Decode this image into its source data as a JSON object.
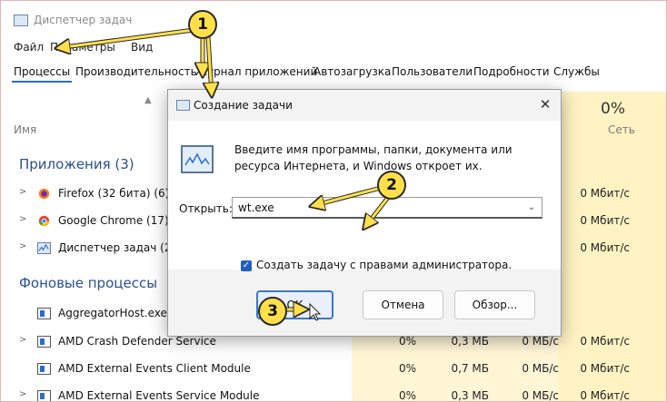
{
  "app": {
    "title": "Диспетчер задач",
    "menu": [
      "Файл",
      "Параметры",
      "Вид"
    ],
    "tabs": [
      "Процессы",
      "Производительность",
      "Журнал приложений",
      "Автозагрузка",
      "Пользователи",
      "Подробности",
      "Службы"
    ],
    "columns": {
      "name": "Имя",
      "network_pct": "0%",
      "network": "Сеть"
    },
    "groups": {
      "apps": "Приложения (3)",
      "background": "Фоновые процессы"
    },
    "apps": [
      {
        "name": "Firefox (32 бита) (6)",
        "net": "0 Мбит/с",
        "icon": "firefox-icon"
      },
      {
        "name": "Google Chrome (17)",
        "net": "0 Мбит/с",
        "icon": "chrome-icon"
      },
      {
        "name": "Диспетчер задач (2)",
        "net": "0 Мбит/с",
        "icon": "task-manager-icon"
      }
    ],
    "background": [
      {
        "name": "AggregatorHost.exe",
        "cpu": "",
        "mem": "",
        "disk": "",
        "net": ""
      },
      {
        "name": "AMD Crash Defender Service",
        "cpu": "0%",
        "mem": "0,3 МБ",
        "disk": "0 МБ/с",
        "net": "0 Мбит/с"
      },
      {
        "name": "AMD External Events Client Module",
        "cpu": "0%",
        "mem": "0,7 МБ",
        "disk": "0 МБ/с",
        "net": "0 Мбит/с"
      },
      {
        "name": "AMD External Events Service Module",
        "cpu": "0%",
        "mem": "0,3 МБ",
        "disk": "0 МБ/с",
        "net": "0 Мбит/с"
      }
    ]
  },
  "dialog": {
    "title": "Создание задачи",
    "description": "Введите имя программы, папки, документа или ресурса Интернета, и Windows откроет их.",
    "open_label": "Открыть:",
    "open_value": "wt.exe",
    "admin_label": "Создать задачу с правами администратора.",
    "admin_checked": true,
    "buttons": {
      "ok": "ОК",
      "cancel": "Отмена",
      "browse": "Обзор..."
    }
  },
  "annotations": {
    "badge_1": "1",
    "badge_2": "2",
    "badge_3": "3"
  },
  "colors": {
    "accent": "#2b6cd1",
    "badge": "#ffe04a",
    "highlight": "#fff3c4"
  }
}
